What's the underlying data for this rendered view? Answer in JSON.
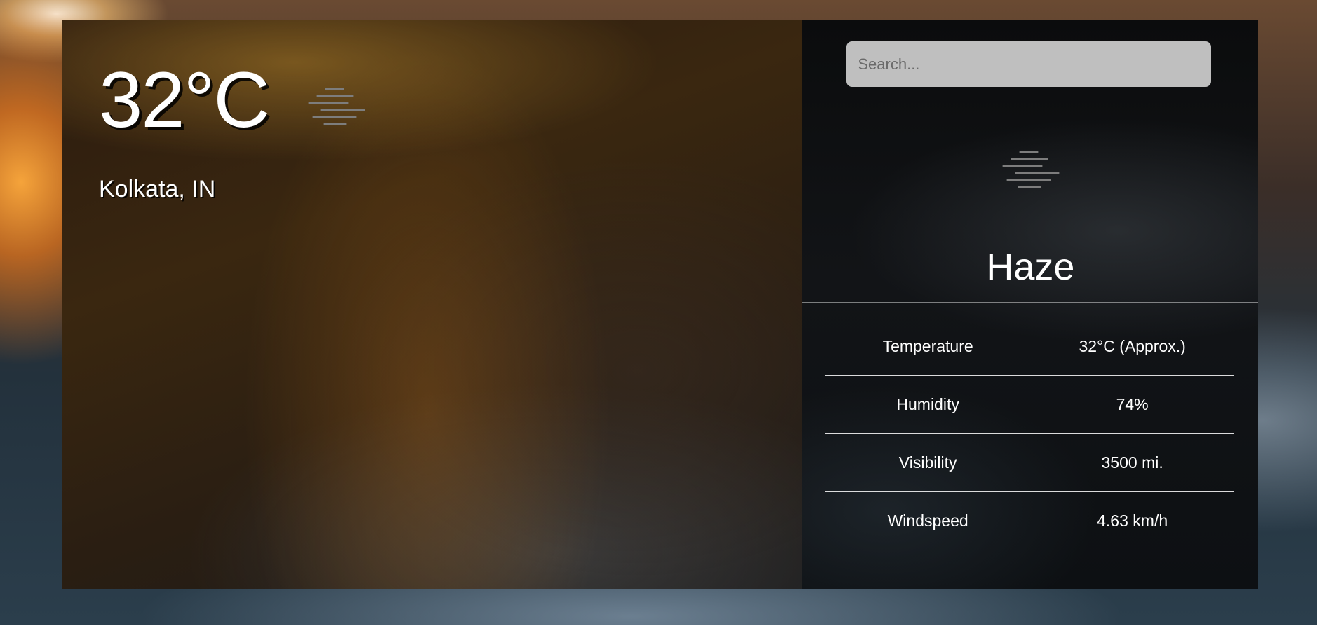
{
  "main": {
    "temperature": "32°C",
    "location": "Kolkata, IN",
    "icon": "haze-icon"
  },
  "search": {
    "placeholder": "Search..."
  },
  "condition": {
    "label": "Haze",
    "icon": "haze-icon"
  },
  "details": [
    {
      "label": "Temperature",
      "value": "32°C (Approx.)"
    },
    {
      "label": "Humidity",
      "value": "74%"
    },
    {
      "label": "Visibility",
      "value": "3500 mi."
    },
    {
      "label": "Windspeed",
      "value": "4.63 km/h"
    }
  ]
}
